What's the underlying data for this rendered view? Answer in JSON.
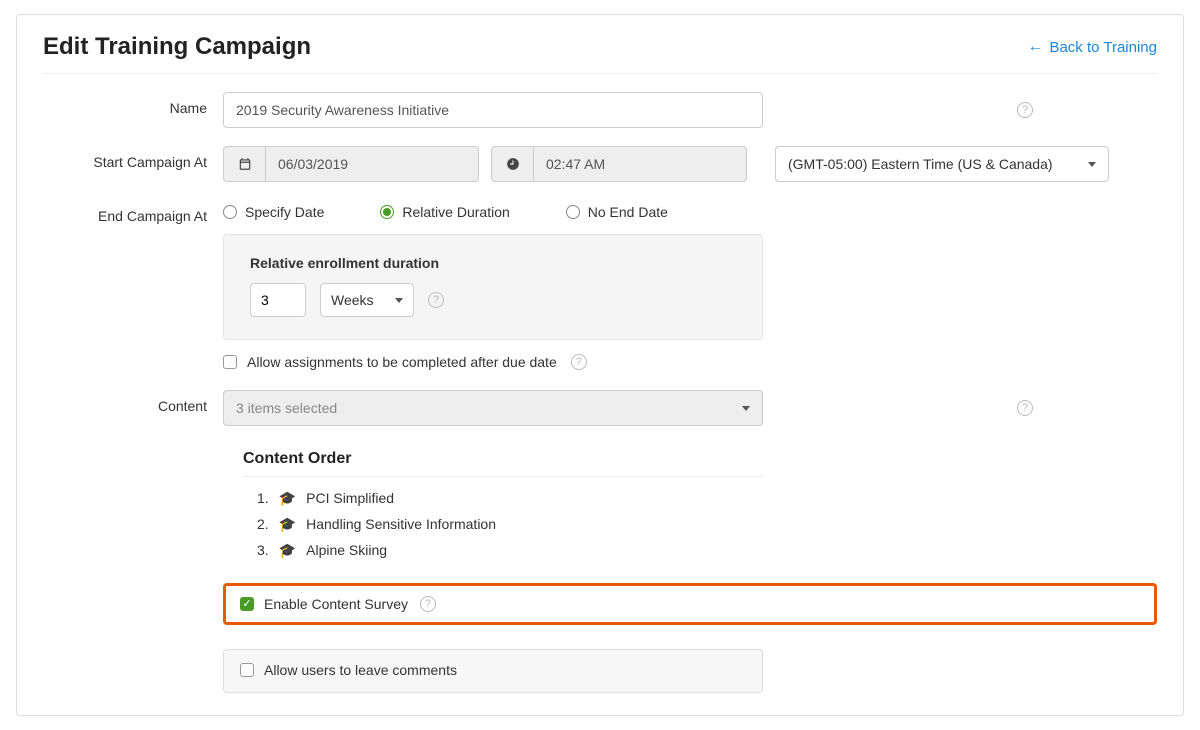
{
  "header": {
    "title": "Edit Training Campaign",
    "back_label": "Back to Training"
  },
  "form": {
    "name": {
      "label": "Name",
      "value": "2019 Security Awareness Initiative"
    },
    "start": {
      "label": "Start Campaign At",
      "date": "06/03/2019",
      "time": "02:47 AM",
      "timezone": "(GMT-05:00) Eastern Time (US & Canada)"
    },
    "end": {
      "label": "End Campaign At",
      "options": {
        "specify": "Specify Date",
        "relative": "Relative Duration",
        "none": "No End Date"
      },
      "selected": "relative",
      "relative_box": {
        "title": "Relative enrollment duration",
        "value": "3",
        "unit": "Weeks"
      }
    },
    "allow_after_due": {
      "label": "Allow assignments to be completed after due date",
      "checked": false
    },
    "content": {
      "label": "Content",
      "selected_text": "3 items selected",
      "order_title": "Content Order",
      "items": [
        {
          "n": "1.",
          "title": "PCI Simplified"
        },
        {
          "n": "2.",
          "title": "Handling Sensitive Information"
        },
        {
          "n": "3.",
          "title": "Alpine Skiing"
        }
      ],
      "enable_survey": {
        "label": "Enable Content Survey",
        "checked": true
      },
      "allow_comments": {
        "label": "Allow users to leave comments",
        "checked": false
      }
    }
  }
}
